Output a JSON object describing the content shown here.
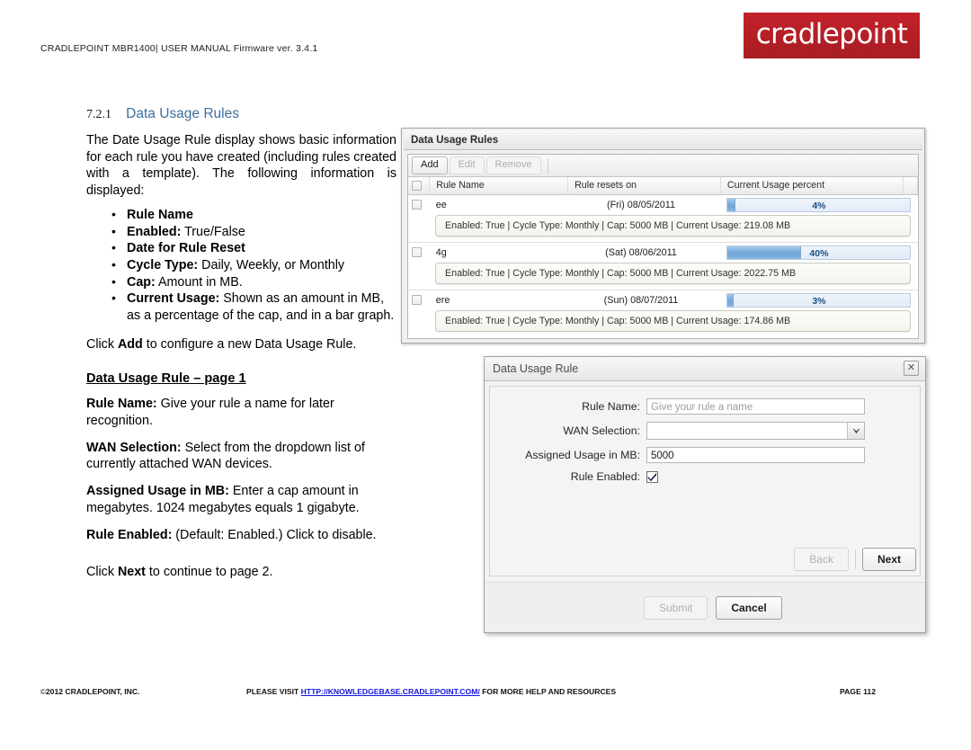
{
  "header": {
    "doc_line": "CRADLEPOINT MBR1400| USER MANUAL Firmware ver. 3.4.1",
    "logo_text": "cradlepoint",
    "logo_color": "#b41f26"
  },
  "section": {
    "number": "7.2.1",
    "title": "Data Usage Rules",
    "title_color": "#3d6f9e",
    "intro": "The Date Usage Rule display shows basic information for each rule you have created (including rules created with a template). The following information is displayed:",
    "bullets": [
      {
        "bold": "Rule Name",
        "rest": ""
      },
      {
        "bold": "Enabled:",
        "rest": " True/False"
      },
      {
        "bold": "Date for Rule Reset",
        "rest": ""
      },
      {
        "bold": "Cycle Type:",
        "rest": " Daily, Weekly, or Monthly"
      },
      {
        "bold": "Cap:",
        "rest": " Amount in MB."
      },
      {
        "bold": "Current Usage:",
        "rest": " Shown as an amount in MB, as a percentage of the cap, and in a bar graph."
      }
    ],
    "click_add_pre": "Click ",
    "click_add_bold": "Add",
    "click_add_post": " to configure a new Data Usage Rule.",
    "subheading": "Data Usage Rule – page 1",
    "definitions": [
      {
        "term": "Rule Name:",
        "desc": " Give your rule a name for later recognition."
      },
      {
        "term": "WAN Selection:",
        "desc": " Select from the dropdown list of currently attached WAN devices."
      },
      {
        "term": "Assigned Usage in MB:",
        "desc": " Enter a cap amount in megabytes. 1024 megabytes equals 1 gigabyte."
      },
      {
        "term": "Rule Enabled:",
        "desc": " (Default: Enabled.) Click to disable."
      }
    ],
    "click_next_pre": "Click ",
    "click_next_bold": "Next",
    "click_next_post": " to continue to page 2."
  },
  "rules_panel": {
    "title": "Data Usage Rules",
    "toolbar": {
      "add": "Add",
      "edit": "Edit",
      "remove": "Remove"
    },
    "columns": [
      "Rule Name",
      "Rule resets on",
      "Current Usage percent"
    ],
    "rows": [
      {
        "name": "ee",
        "resets_on": "(Fri) 08/05/2011",
        "percent_label": "4%",
        "percent_value": 4,
        "detail": "Enabled: True | Cycle Type: Monthly | Cap: 5000 MB | Current Usage: 219.08 MB"
      },
      {
        "name": "4g",
        "resets_on": "(Sat) 08/06/2011",
        "percent_label": "40%",
        "percent_value": 40,
        "detail": "Enabled: True | Cycle Type: Monthly | Cap: 5000 MB | Current Usage: 2022.75 MB"
      },
      {
        "name": "ere",
        "resets_on": "(Sun) 08/07/2011",
        "percent_label": "3%",
        "percent_value": 3,
        "detail": "Enabled: True | Cycle Type: Monthly | Cap: 5000 MB | Current Usage: 174.86 MB"
      }
    ]
  },
  "dialog": {
    "title": "Data Usage Rule",
    "close_label": "✕",
    "fields": {
      "rule_name_label": "Rule Name:",
      "rule_name_value": "",
      "rule_name_placeholder": "Give your rule a name",
      "wan_selection_label": "WAN Selection:",
      "wan_selection_value": "",
      "assigned_usage_label": "Assigned Usage in MB:",
      "assigned_usage_value": "5000",
      "rule_enabled_label": "Rule Enabled:",
      "rule_enabled_checked": true
    },
    "buttons": {
      "back": "Back",
      "next": "Next",
      "submit": "Submit",
      "cancel": "Cancel"
    }
  },
  "footer": {
    "copyright_symbol": "©",
    "copyright": "2012 CRADLEPOINT, INC.",
    "center_pre": "PLEASE VISIT ",
    "url": "HTTP://KNOWLEDGEBASE.CRADLEPOINT.COM/",
    "center_post": " FOR MORE HELP AND RESOURCES",
    "page": "PAGE 112"
  }
}
